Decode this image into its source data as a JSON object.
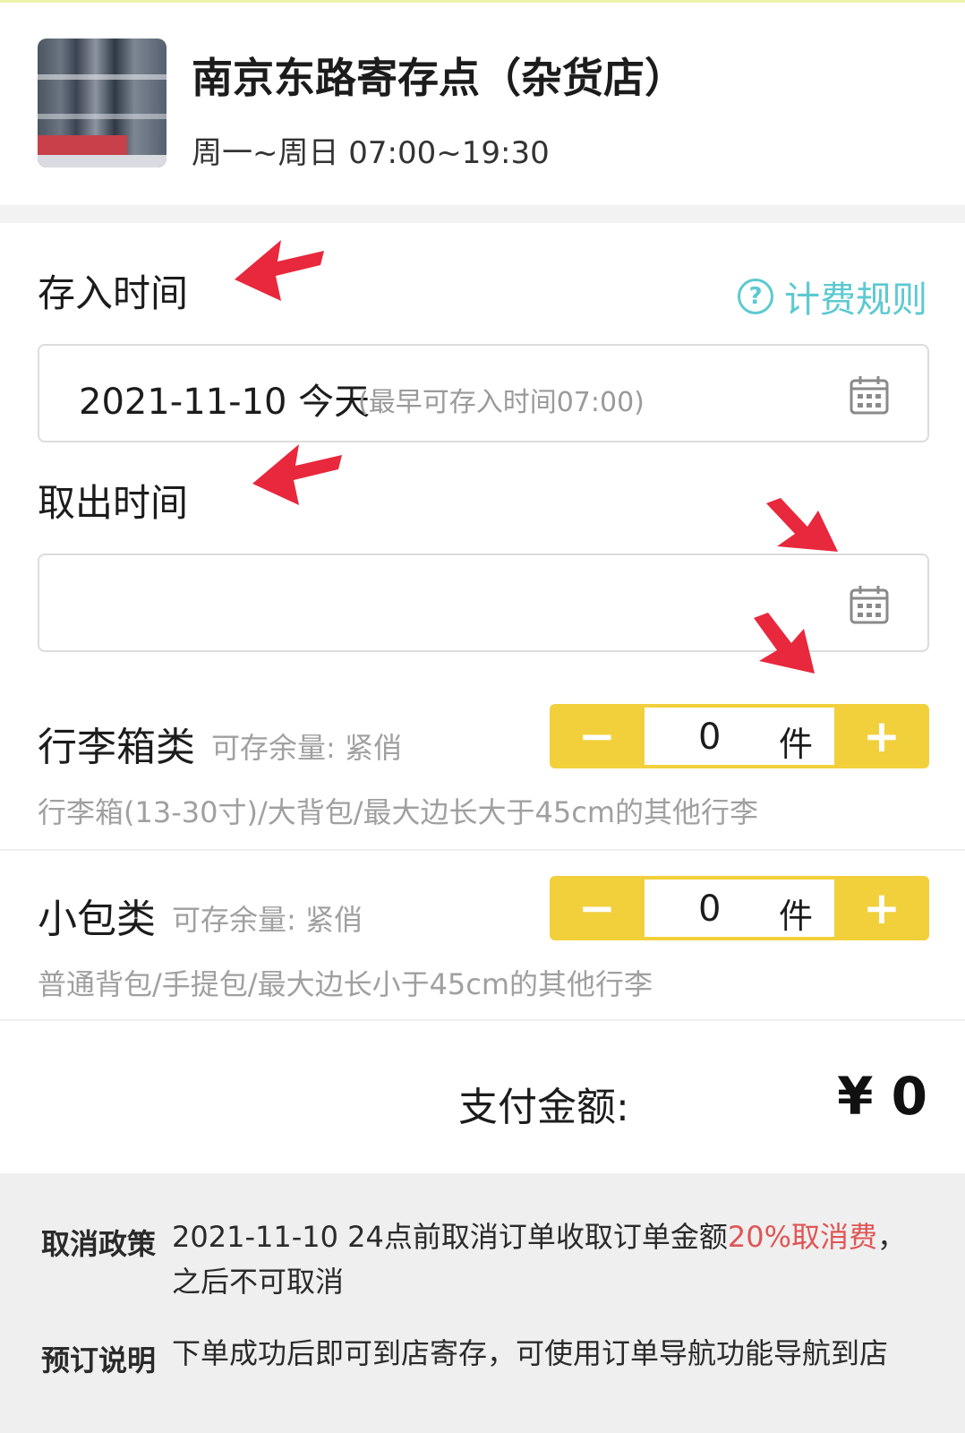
{
  "store": {
    "name": "南京东路寄存点（杂货店）",
    "hours": "周一~周日 07:00~19:30"
  },
  "deposit": {
    "label": "存入时间",
    "date": "2021-11-10 今天",
    "hint": "(最早可存入时间07:00)"
  },
  "rules_link": "计费规则",
  "pickup": {
    "label": "取出时间",
    "date": ""
  },
  "luggage": {
    "title": "行李箱类",
    "availability": "可存余量: 紧俏",
    "description": "行李箱(13-30寸)/大背包/最大边长大于45cm的其他行李",
    "count": "0",
    "unit": "件"
  },
  "small_bag": {
    "title": "小包类",
    "availability": "可存余量: 紧俏",
    "description": "普通背包/手提包/最大边长小于45cm的其他行李",
    "count": "0",
    "unit": "件"
  },
  "payment": {
    "label": "支付金额:",
    "amount": "¥ 0"
  },
  "policy": {
    "cancel_label": "取消政策",
    "cancel_text_a": "2021-11-10 24点前取消订单收取订单金额",
    "cancel_text_red": "20%取消费",
    "cancel_text_b": "，之后不可取消",
    "booking_label": "预订说明",
    "booking_text": "下单成功后即可到店寄存，可使用订单导航功能导航到店"
  },
  "colors": {
    "accent_yellow": "#f2d03c",
    "link_teal": "#5cc9d1",
    "highlight_red": "#e05555",
    "annotation_arrow": "#e8283c"
  },
  "icons": [
    "calendar-icon",
    "question-circle-icon",
    "minus-icon",
    "plus-icon",
    "annotation-arrow"
  ]
}
